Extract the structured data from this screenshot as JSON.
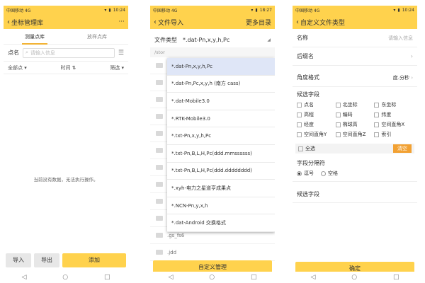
{
  "status": {
    "p1_left": "中国移动 4G",
    "p1_time": "10:24",
    "p2_left": "中国移动 4G",
    "p2_time": "18:27",
    "p3_left": "中国移动 4G",
    "p3_time": "10:24"
  },
  "p1": {
    "title": "坐标管理库",
    "menu": "···",
    "tabs": [
      "测量点库",
      "放样点库"
    ],
    "search_label": "点名",
    "search_placeholder": "请输入信息",
    "filters": [
      "全部点",
      "时间",
      "筛选"
    ],
    "empty": "当前没有数据，无法执行操作。",
    "buttons": {
      "import": "导入",
      "export": "导出",
      "add": "添加"
    }
  },
  "p2": {
    "title": "文件导入",
    "more": "更多目录",
    "filetype_label": "文件类型",
    "filetype_value": "*.dat-Pn,x,y,h,Pc",
    "path": "/stor",
    "files": [
      ".gs_fs6",
      ".jdd"
    ],
    "options": [
      "*.dat-Pn,x,y,h,Pc",
      "*.dat-Pn,Pc,x,y,h (南方 cass)",
      "*.dat-Mobile3.0",
      "*.RTK-Mobile3.0",
      "*.txt-Pn,x,y,h,Pc",
      "*.txt-Pn,B,L,H,Pc(ddd.mmssssss)",
      "*.txt-Pn,B,L,H,Pc(ddd.dddddddd)",
      "*.xyh-电力之星道亨成果点",
      "*.NCN-Pn,y,x,h",
      "*.dat-Android 交换格式"
    ],
    "custom_button": "自定义管理"
  },
  "p3": {
    "title": "自定义文件类型",
    "name_label": "名称",
    "name_placeholder": "请输入信息",
    "suffix_label": "后缀名",
    "angle_label": "角度格式",
    "angle_value": "度.分秒",
    "candidates_label": "候选字段",
    "fields": [
      "点名",
      "北坐标",
      "东坐标",
      "高程",
      "编码",
      "纬度",
      "经度",
      "椭球高",
      "空间直角X",
      "空间直角Y",
      "空间直角Z",
      "索引"
    ],
    "select_all": "全选",
    "clear": "清空",
    "separator_label": "字段分隔符",
    "sep_options": [
      "逗号",
      "空格"
    ],
    "selected_label": "候选字段",
    "confirm": "确定"
  },
  "nav": {
    "back": "◁",
    "home": "○",
    "recent": "□"
  },
  "colors": {
    "accent": "#ffd24d",
    "clear": "#f2a133"
  }
}
